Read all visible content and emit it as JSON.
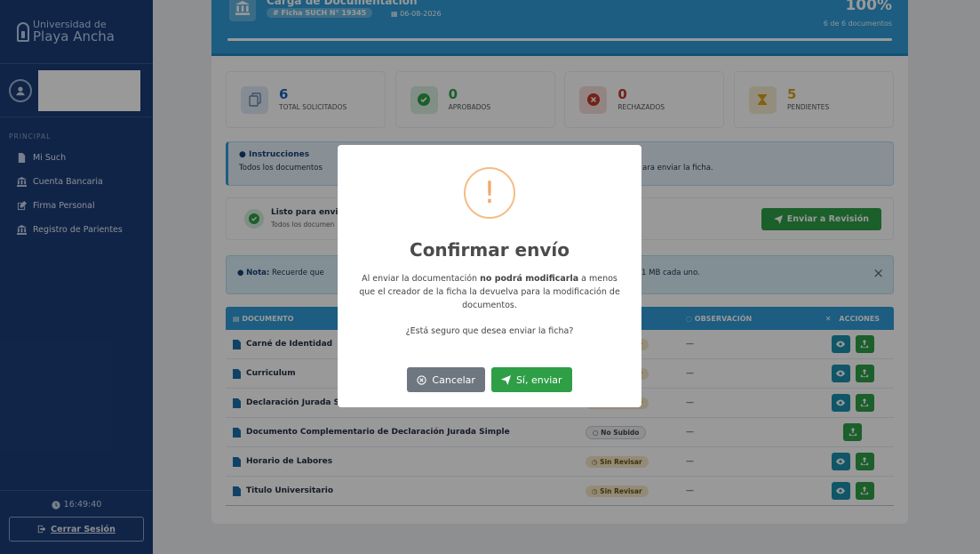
{
  "brand": {
    "line1": "Universidad de",
    "line2": "Playa Ancha"
  },
  "sidebar": {
    "section": "PRINCIPAL",
    "items": [
      {
        "label": "Mi Such",
        "icon": "file-icon"
      },
      {
        "label": "Cuenta Bancaria",
        "icon": "bank-icon"
      },
      {
        "label": "Firma Personal",
        "icon": "edit-icon"
      },
      {
        "label": "Registro de Parientes",
        "icon": "bank-icon"
      }
    ],
    "clock": "16:49:40",
    "logout": "Cerrar Sesión"
  },
  "header": {
    "title": "Carga de Documentación",
    "ficha": "# Ficha SUCH N° 19345",
    "date": "06-08-2026",
    "progress_pct": "100%",
    "progress_value": 100,
    "progress_sub": "6 de 6 documentos"
  },
  "stats": [
    {
      "value": "6",
      "label": "TOTAL SOLICITADOS",
      "color": "#1c63b7",
      "icon": "copy-icon"
    },
    {
      "value": "0",
      "label": "APROBADOS",
      "color": "#2e9e47",
      "icon": "check-icon"
    },
    {
      "value": "0",
      "label": "RECHAZADOS",
      "color": "#c0392b",
      "icon": "x-icon"
    },
    {
      "value": "5",
      "label": "PENDIENTES",
      "color": "#d9a21b",
      "icon": "hourglass-icon"
    }
  ],
  "instructions": {
    "title": "Instrucciones",
    "text_left": "Todos los documentos",
    "text_right": "ara enviar la ficha."
  },
  "ready": {
    "title": "Listo para envi",
    "sub": "Todos los documen",
    "button": "Enviar a Revisión"
  },
  "note": {
    "label": "Nota:",
    "text_left": "Recuerde que",
    "text_right": "1 MB cada uno."
  },
  "table": {
    "headers": {
      "doc": "DOCUMENTO",
      "obs": "OBSERVACIÓN",
      "acc": "ACCIONES"
    },
    "rows": [
      {
        "doc": "Carné de Identidad",
        "status": "Sin Revisar",
        "kind": "sin",
        "obs": "—",
        "view": true
      },
      {
        "doc": "Curriculum",
        "status": "Sin Revisar",
        "kind": "sin",
        "obs": "—",
        "view": true
      },
      {
        "doc": "Declaración Jurada Simple",
        "status": "Sin Revisar",
        "kind": "sin",
        "obs": "—",
        "view": true
      },
      {
        "doc": "Documento Complementario de Declaración Jurada Simple",
        "status": "No Subido",
        "kind": "no",
        "obs": "—",
        "view": false
      },
      {
        "doc": "Horario de Labores",
        "status": "Sin Revisar",
        "kind": "sin",
        "obs": "—",
        "view": true
      },
      {
        "doc": "Titulo Universitario",
        "status": "Sin Revisar",
        "kind": "sin",
        "obs": "—",
        "view": true
      }
    ]
  },
  "modal": {
    "title": "Confirmar envío",
    "body_pre": "Al enviar la documentación ",
    "body_bold": "no podrá modificarla",
    "body_post": " a menos que el creador de la ficha la devuelva para la modificación de documentos.",
    "question": "¿Está seguro que desea enviar la ficha?",
    "cancel": "Cancelar",
    "confirm": "Sí, enviar"
  }
}
